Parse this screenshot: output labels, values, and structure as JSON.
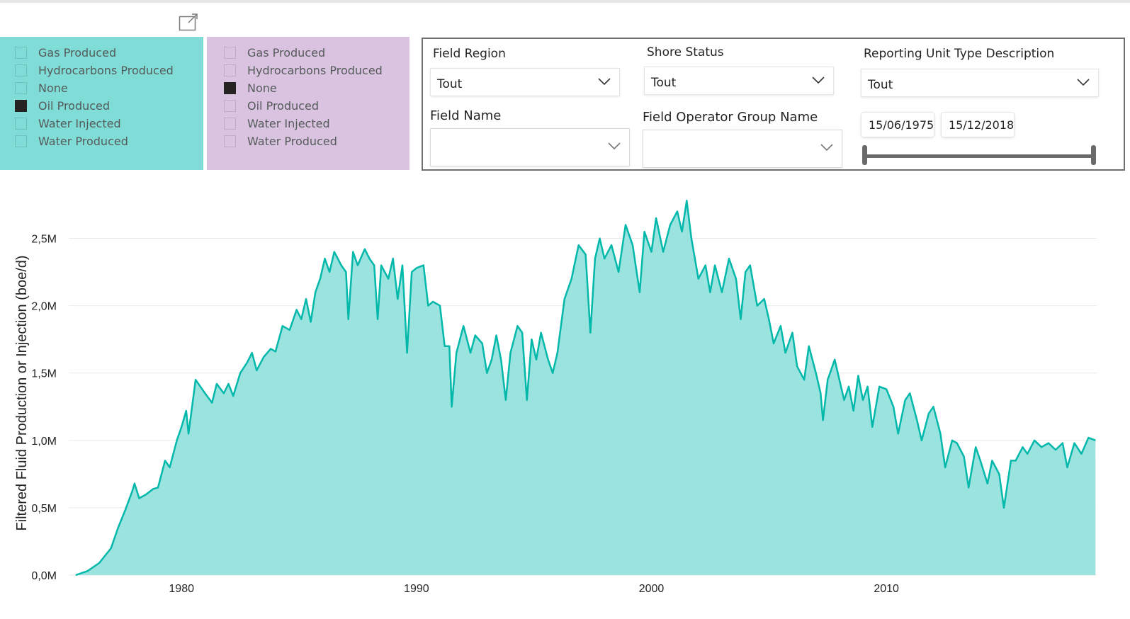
{
  "slicer_left": {
    "items": [
      {
        "label": "Gas Produced",
        "checked": false
      },
      {
        "label": "Hydrocarbons Produced",
        "checked": false
      },
      {
        "label": "None",
        "checked": false
      },
      {
        "label": "Oil Produced",
        "checked": true
      },
      {
        "label": "Water Injected",
        "checked": false
      },
      {
        "label": "Water Produced",
        "checked": false
      }
    ]
  },
  "slicer_right": {
    "items": [
      {
        "label": "Gas Produced",
        "checked": false
      },
      {
        "label": "Hydrocarbons Produced",
        "checked": false
      },
      {
        "label": "None",
        "checked": true
      },
      {
        "label": "Oil Produced",
        "checked": false
      },
      {
        "label": "Water Injected",
        "checked": false
      },
      {
        "label": "Water Produced",
        "checked": false
      }
    ]
  },
  "filters": {
    "field_region": {
      "label": "Field Region",
      "value": "Tout"
    },
    "shore_status": {
      "label": "Shore Status",
      "value": "Tout"
    },
    "reporting_unit": {
      "label": "Reporting Unit Type Description",
      "value": "Tout"
    },
    "field_name": {
      "label": "Field Name",
      "value": ""
    },
    "field_operator": {
      "label": "Field Operator Group Name",
      "value": ""
    },
    "date_range": {
      "start": "15/06/1975",
      "end": "15/12/2018",
      "start_fraction": 0.0,
      "end_fraction": 1.0
    }
  },
  "colors": {
    "accent": "#01b8aa",
    "area_fill": "#9ae3de",
    "slicer_teal": "#7fdcd6",
    "slicer_lilac": "#d9c3e0",
    "checked": "#252423"
  },
  "icons": {
    "focus_mode": "focus-mode-icon",
    "dropdown": "chevron-down-icon"
  },
  "chart_data": {
    "type": "area",
    "title": "",
    "xlabel": "",
    "ylabel": "Filtered Fluid Production or Injection (boe/d)",
    "x_ticks": [
      {
        "value": 1980,
        "label": "1980"
      },
      {
        "value": 1990,
        "label": "1990"
      },
      {
        "value": 2000,
        "label": "2000"
      },
      {
        "value": 2010,
        "label": "2010"
      }
    ],
    "y_ticks": [
      {
        "value": 0,
        "label": "0,0M"
      },
      {
        "value": 0.5,
        "label": "0,5M"
      },
      {
        "value": 1.0,
        "label": "1,0M"
      },
      {
        "value": 1.5,
        "label": "1,5M"
      },
      {
        "value": 2.0,
        "label": "2,0M"
      },
      {
        "value": 2.5,
        "label": "2,5M"
      }
    ],
    "xlim": [
      1975.2,
      2018.95
    ],
    "ylim": [
      0,
      2.85
    ],
    "y_unit": "M",
    "grid": true,
    "legend": "none",
    "series": [
      {
        "name": "",
        "color": "#01b8aa",
        "points": [
          [
            1975.5,
            0.0
          ],
          [
            1976.0,
            0.03
          ],
          [
            1976.5,
            0.09
          ],
          [
            1977.0,
            0.2
          ],
          [
            1977.3,
            0.35
          ],
          [
            1977.6,
            0.48
          ],
          [
            1977.9,
            0.62
          ],
          [
            1978.0,
            0.68
          ],
          [
            1978.2,
            0.57
          ],
          [
            1978.5,
            0.6
          ],
          [
            1978.8,
            0.64
          ],
          [
            1979.0,
            0.65
          ],
          [
            1979.3,
            0.85
          ],
          [
            1979.5,
            0.8
          ],
          [
            1979.8,
            1.0
          ],
          [
            1980.0,
            1.1
          ],
          [
            1980.2,
            1.22
          ],
          [
            1980.3,
            1.05
          ],
          [
            1980.6,
            1.45
          ],
          [
            1981.0,
            1.35
          ],
          [
            1981.3,
            1.28
          ],
          [
            1981.5,
            1.42
          ],
          [
            1981.8,
            1.35
          ],
          [
            1982.0,
            1.42
          ],
          [
            1982.2,
            1.33
          ],
          [
            1982.5,
            1.5
          ],
          [
            1982.8,
            1.58
          ],
          [
            1983.0,
            1.65
          ],
          [
            1983.2,
            1.52
          ],
          [
            1983.5,
            1.62
          ],
          [
            1983.8,
            1.68
          ],
          [
            1984.0,
            1.66
          ],
          [
            1984.3,
            1.85
          ],
          [
            1984.6,
            1.82
          ],
          [
            1984.9,
            1.97
          ],
          [
            1985.1,
            1.9
          ],
          [
            1985.3,
            2.05
          ],
          [
            1985.5,
            1.88
          ],
          [
            1985.7,
            2.1
          ],
          [
            1985.9,
            2.2
          ],
          [
            1986.1,
            2.35
          ],
          [
            1986.3,
            2.25
          ],
          [
            1986.5,
            2.4
          ],
          [
            1986.8,
            2.3
          ],
          [
            1987.0,
            2.25
          ],
          [
            1987.1,
            1.9
          ],
          [
            1987.3,
            2.4
          ],
          [
            1987.5,
            2.3
          ],
          [
            1987.8,
            2.42
          ],
          [
            1988.0,
            2.35
          ],
          [
            1988.2,
            2.3
          ],
          [
            1988.35,
            1.9
          ],
          [
            1988.5,
            2.3
          ],
          [
            1988.8,
            2.2
          ],
          [
            1989.0,
            2.35
          ],
          [
            1989.2,
            2.05
          ],
          [
            1989.4,
            2.3
          ],
          [
            1989.6,
            1.65
          ],
          [
            1989.8,
            2.25
          ],
          [
            1990.0,
            2.28
          ],
          [
            1990.3,
            2.3
          ],
          [
            1990.5,
            2.0
          ],
          [
            1990.7,
            2.03
          ],
          [
            1991.0,
            2.0
          ],
          [
            1991.2,
            1.7
          ],
          [
            1991.4,
            1.7
          ],
          [
            1991.5,
            1.25
          ],
          [
            1991.7,
            1.65
          ],
          [
            1992.0,
            1.85
          ],
          [
            1992.3,
            1.65
          ],
          [
            1992.5,
            1.78
          ],
          [
            1992.8,
            1.72
          ],
          [
            1993.0,
            1.5
          ],
          [
            1993.2,
            1.6
          ],
          [
            1993.4,
            1.78
          ],
          [
            1993.6,
            1.6
          ],
          [
            1993.8,
            1.3
          ],
          [
            1994.0,
            1.65
          ],
          [
            1994.3,
            1.85
          ],
          [
            1994.5,
            1.8
          ],
          [
            1994.7,
            1.3
          ],
          [
            1994.9,
            1.75
          ],
          [
            1995.1,
            1.6
          ],
          [
            1995.3,
            1.8
          ],
          [
            1995.6,
            1.6
          ],
          [
            1995.8,
            1.5
          ],
          [
            1996.0,
            1.65
          ],
          [
            1996.3,
            2.05
          ],
          [
            1996.6,
            2.2
          ],
          [
            1996.9,
            2.45
          ],
          [
            1997.2,
            2.38
          ],
          [
            1997.4,
            1.8
          ],
          [
            1997.6,
            2.35
          ],
          [
            1997.8,
            2.5
          ],
          [
            1998.0,
            2.35
          ],
          [
            1998.3,
            2.45
          ],
          [
            1998.6,
            2.25
          ],
          [
            1998.9,
            2.6
          ],
          [
            1999.2,
            2.45
          ],
          [
            1999.5,
            2.1
          ],
          [
            1999.7,
            2.55
          ],
          [
            2000.0,
            2.4
          ],
          [
            2000.2,
            2.65
          ],
          [
            2000.5,
            2.4
          ],
          [
            2000.8,
            2.6
          ],
          [
            2001.1,
            2.7
          ],
          [
            2001.3,
            2.55
          ],
          [
            2001.5,
            2.78
          ],
          [
            2001.7,
            2.5
          ],
          [
            2002.0,
            2.2
          ],
          [
            2002.3,
            2.3
          ],
          [
            2002.5,
            2.1
          ],
          [
            2002.7,
            2.3
          ],
          [
            2003.0,
            2.1
          ],
          [
            2003.3,
            2.35
          ],
          [
            2003.6,
            2.2
          ],
          [
            2003.8,
            1.9
          ],
          [
            2004.0,
            2.25
          ],
          [
            2004.2,
            2.3
          ],
          [
            2004.5,
            2.0
          ],
          [
            2004.8,
            2.05
          ],
          [
            2005.0,
            1.9
          ],
          [
            2005.2,
            1.72
          ],
          [
            2005.5,
            1.85
          ],
          [
            2005.7,
            1.65
          ],
          [
            2006.0,
            1.8
          ],
          [
            2006.2,
            1.55
          ],
          [
            2006.5,
            1.45
          ],
          [
            2006.7,
            1.7
          ],
          [
            2007.0,
            1.5
          ],
          [
            2007.2,
            1.35
          ],
          [
            2007.3,
            1.15
          ],
          [
            2007.5,
            1.45
          ],
          [
            2007.8,
            1.6
          ],
          [
            2008.0,
            1.45
          ],
          [
            2008.2,
            1.3
          ],
          [
            2008.4,
            1.4
          ],
          [
            2008.6,
            1.22
          ],
          [
            2008.8,
            1.48
          ],
          [
            2009.0,
            1.3
          ],
          [
            2009.2,
            1.4
          ],
          [
            2009.4,
            1.1
          ],
          [
            2009.7,
            1.4
          ],
          [
            2010.0,
            1.38
          ],
          [
            2010.3,
            1.25
          ],
          [
            2010.5,
            1.05
          ],
          [
            2010.8,
            1.3
          ],
          [
            2011.0,
            1.35
          ],
          [
            2011.3,
            1.15
          ],
          [
            2011.5,
            1.0
          ],
          [
            2011.8,
            1.2
          ],
          [
            2012.0,
            1.25
          ],
          [
            2012.3,
            1.05
          ],
          [
            2012.5,
            0.8
          ],
          [
            2012.8,
            1.0
          ],
          [
            2013.0,
            0.98
          ],
          [
            2013.3,
            0.88
          ],
          [
            2013.5,
            0.65
          ],
          [
            2013.8,
            0.95
          ],
          [
            2014.0,
            0.85
          ],
          [
            2014.3,
            0.68
          ],
          [
            2014.5,
            0.85
          ],
          [
            2014.8,
            0.75
          ],
          [
            2015.0,
            0.5
          ],
          [
            2015.3,
            0.85
          ],
          [
            2015.5,
            0.85
          ],
          [
            2015.8,
            0.95
          ],
          [
            2016.0,
            0.9
          ],
          [
            2016.3,
            1.0
          ],
          [
            2016.6,
            0.95
          ],
          [
            2016.9,
            0.98
          ],
          [
            2017.2,
            0.93
          ],
          [
            2017.5,
            0.98
          ],
          [
            2017.7,
            0.8
          ],
          [
            2018.0,
            0.98
          ],
          [
            2018.3,
            0.9
          ],
          [
            2018.6,
            1.02
          ],
          [
            2018.9,
            1.0
          ]
        ]
      }
    ]
  }
}
